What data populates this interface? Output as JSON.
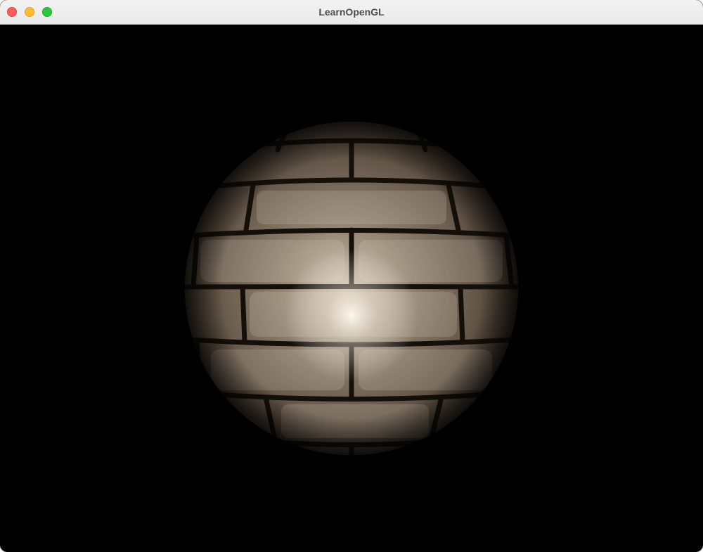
{
  "window": {
    "title": "LearnOpenGL"
  },
  "controls": {
    "close": "close-button",
    "minimize": "minimize-button",
    "zoom": "zoom-button"
  },
  "colors": {
    "close": "#fe5f57",
    "minimize": "#febc2e",
    "zoom": "#28c840",
    "background": "#000000",
    "brick_light": "#a89a88",
    "brick_dark": "#3d332a"
  },
  "scene": {
    "object": "brick-textured-sphere"
  }
}
